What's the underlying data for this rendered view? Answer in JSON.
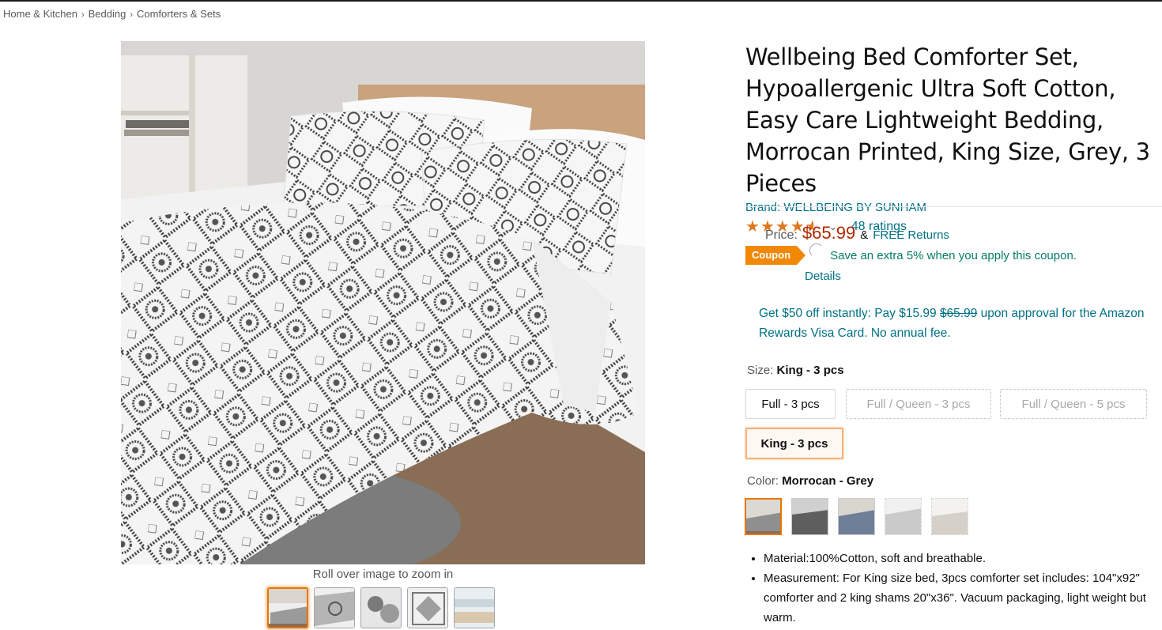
{
  "breadcrumb": [
    "Home & Kitchen",
    "Bedding",
    "Comforters & Sets"
  ],
  "gallery": {
    "zoom_hint": "Roll over image to zoom in",
    "thumbnail_count": 5
  },
  "product": {
    "title": "Wellbeing Bed Comforter Set, Hypoallergenic Ultra Soft Cotton, Easy Care Lightweight Bedding, Morrocan Printed, King Size, Grey, 3 Pieces",
    "brand": "Brand: WELLBEING BY SUNHAM",
    "rating_stars": 4.5,
    "ratings": "48 ratings"
  },
  "price": {
    "label": "Price:",
    "value": "$65.99",
    "amp": "&",
    "returns": "FREE Returns"
  },
  "coupon": {
    "badge": "Coupon",
    "text": "Save an extra 5% when you apply this coupon.",
    "details": "Details"
  },
  "visa_offer": {
    "prefix": "Get $50 off instantly: Pay $15.99",
    "strike": "$65.99",
    "suffix": "upon approval for the Amazon Rewards Visa Card. No annual fee."
  },
  "size": {
    "label": "Size:",
    "selected": "King - 3 pcs",
    "options": [
      "Full - 3 pcs",
      "Full / Queen - 3 pcs",
      "Full / Queen - 5 pcs",
      "King - 3 pcs"
    ]
  },
  "color": {
    "label": "Color:",
    "selected": "Morrocan - Grey",
    "swatch_count": 5
  },
  "bullets": [
    "Material:100%Cotton, soft and breathable.",
    "Measurement: For King size bed, 3pcs comforter set includes: 104\"x92\" comforter and 2 king shams 20\"x36\". Vacuum packaging, light weight but warm."
  ],
  "colors": {
    "link": "#007185",
    "price": "#b12704",
    "coupon": "#f08804",
    "coupon_text": "#067d62",
    "star": "#de7921",
    "selected_border": "#e77600"
  }
}
